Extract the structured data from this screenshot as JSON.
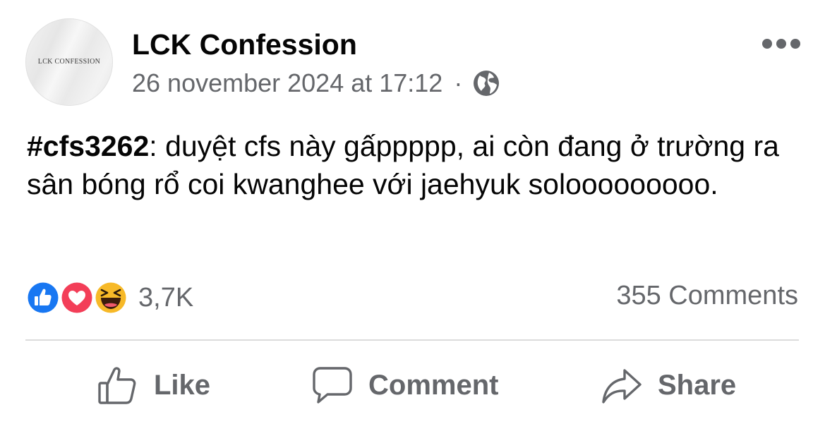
{
  "post": {
    "page_name": "LCK Confession",
    "avatar_text": "LCK CONFESSION",
    "timestamp": "26 november 2024 at 17:12",
    "separator": "·",
    "audience_icon": "globe-icon",
    "more_icon": "more-options-icon",
    "hashtag": "#cfs3262",
    "body": ": duyệt cfs này gấppppp, ai còn đang ở trường ra sân bóng rổ coi kwanghee với jaehyuk solooooooooo."
  },
  "engagement": {
    "reactions": [
      {
        "type": "like",
        "icon": "like-reaction-icon",
        "color": "#1877f2"
      },
      {
        "type": "love",
        "icon": "love-reaction-icon",
        "color": "#f33e58"
      },
      {
        "type": "haha",
        "icon": "haha-reaction-icon",
        "color": "#f7b928"
      }
    ],
    "reaction_count": "3,7K",
    "comments_count": "355 Comments"
  },
  "actions": {
    "like": "Like",
    "comment": "Comment",
    "share": "Share"
  }
}
